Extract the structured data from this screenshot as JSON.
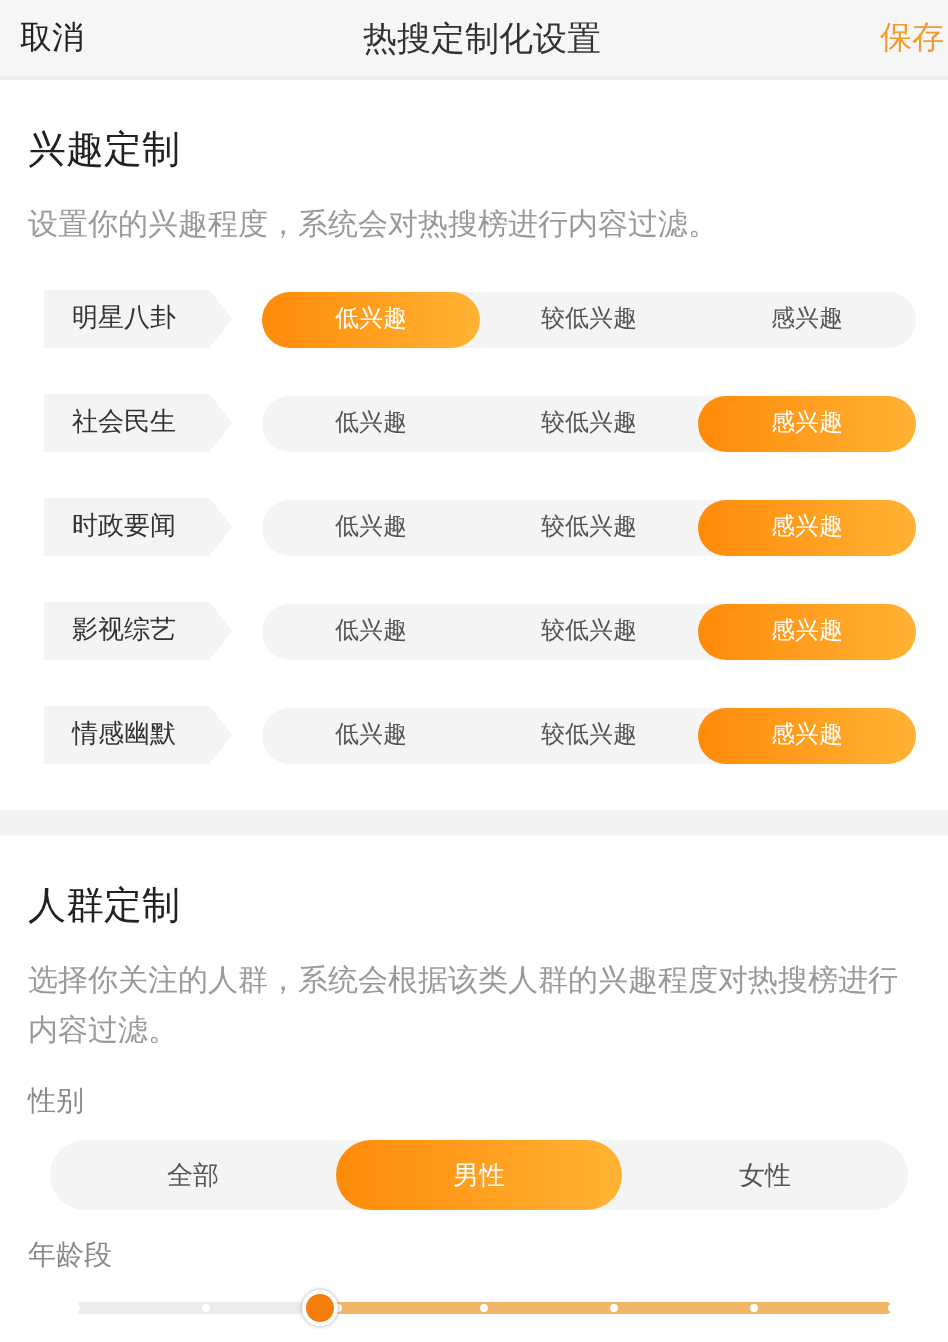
{
  "nav_bar": {
    "cancel": "取消",
    "title": "热搜定制化设置",
    "save": "保存"
  },
  "interest_section": {
    "title": "兴趣定制",
    "description": "设置你的兴趣程度，系统会对热搜榜进行内容过滤。",
    "rows": [
      {
        "label": "明星八卦",
        "options": [
          {
            "label": "低兴趣",
            "selected": true
          },
          {
            "label": "较低兴趣",
            "selected": false
          },
          {
            "label": "感兴趣",
            "selected": false
          }
        ]
      },
      {
        "label": "社会民生",
        "options": [
          {
            "label": "低兴趣",
            "selected": false
          },
          {
            "label": "较低兴趣",
            "selected": false
          },
          {
            "label": "感兴趣",
            "selected": true
          }
        ]
      },
      {
        "label": "时政要闻",
        "options": [
          {
            "label": "低兴趣",
            "selected": false
          },
          {
            "label": "较低兴趣",
            "selected": false
          },
          {
            "label": "感兴趣",
            "selected": true
          }
        ]
      },
      {
        "label": "影视综艺",
        "options": [
          {
            "label": "低兴趣",
            "selected": false
          },
          {
            "label": "较低兴趣",
            "selected": false
          },
          {
            "label": "感兴趣",
            "selected": true
          }
        ]
      },
      {
        "label": "情感幽默",
        "options": [
          {
            "label": "低兴趣",
            "selected": false
          },
          {
            "label": "较低兴趣",
            "selected": false
          },
          {
            "label": "感兴趣",
            "selected": true
          }
        ]
      }
    ]
  },
  "crowd_section": {
    "title": "人群定制",
    "description": "选择你关注的人群，系统会根据该类人群的兴趣程度对热搜榜进行内容过滤。",
    "gender": {
      "label": "性别",
      "options": [
        {
          "label": "全部",
          "selected": false
        },
        {
          "label": "男性",
          "selected": true
        },
        {
          "label": "女性",
          "selected": false
        }
      ]
    },
    "age": {
      "label": "年龄段",
      "level": 0.7
    }
  }
}
